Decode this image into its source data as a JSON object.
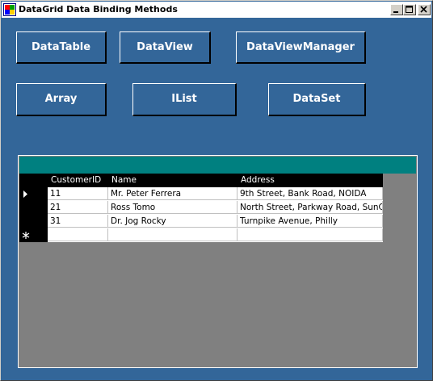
{
  "window": {
    "title": "DataGrid Data Binding Methods"
  },
  "buttons": {
    "datatable": "DataTable",
    "dataview": "DataView",
    "dataviewmanager": "DataViewManager",
    "array": "Array",
    "ilist": "IList",
    "dataset": "DataSet"
  },
  "grid": {
    "columns": [
      "CustomerID",
      "Name",
      "Address"
    ],
    "rows": [
      {
        "id": "11",
        "name": "Mr. Peter Ferrera",
        "address": "9th Street, Bank Road, NOIDA"
      },
      {
        "id": "21",
        "name": "Ross Tomo",
        "address": "North Street, Parkway Road, SunCity"
      },
      {
        "id": "31",
        "name": "Dr. Jog Rocky",
        "address": "Turnpike Avenue, Philly"
      }
    ],
    "new_row_marker_icon": "asterisk-icon",
    "current_row_icon": "row-pointer-icon"
  },
  "colors": {
    "form_background": "#336699",
    "caption": "#008080",
    "grid_background": "#808080"
  }
}
